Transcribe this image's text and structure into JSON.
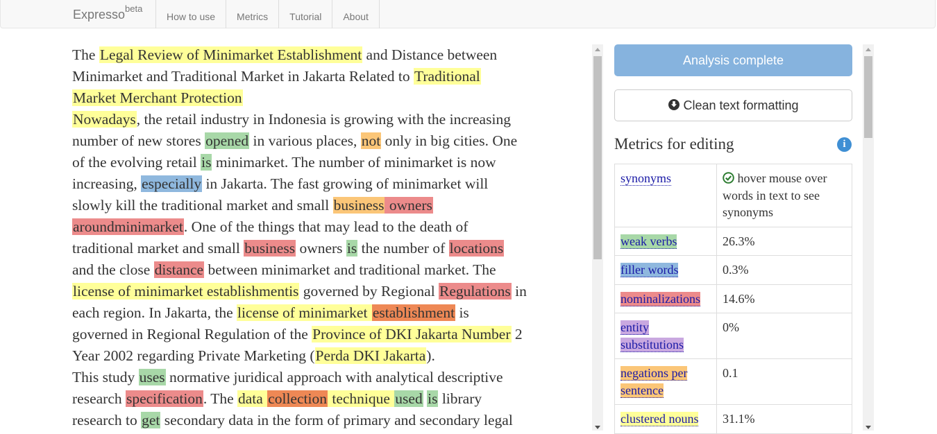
{
  "navbar": {
    "brand": "Expresso",
    "brand_sup": "beta",
    "items": [
      "How to use",
      "Metrics",
      "Tutorial",
      "About"
    ]
  },
  "text_lines": [
    [
      [
        "",
        "The "
      ],
      [
        "y",
        "Legal Review of Minimarket Establishment"
      ],
      [
        "",
        " and Distance between"
      ]
    ],
    [
      [
        "",
        "Minimarket and Traditional Market in Jakarta Related to "
      ],
      [
        "y",
        "Traditional "
      ]
    ],
    [
      [
        "y",
        "Market Merchant Protection"
      ]
    ],
    [
      [
        "y",
        "Nowadays"
      ],
      [
        "",
        ", the retail industry in Indonesia is growing with the increasing"
      ]
    ],
    [
      [
        "",
        "number of new stores "
      ],
      [
        "g",
        "opened"
      ],
      [
        "",
        " in various places, "
      ],
      [
        "o",
        "not"
      ],
      [
        "",
        " only in big cities. One"
      ]
    ],
    [
      [
        "",
        "of the evolving retail "
      ],
      [
        "g",
        "is"
      ],
      [
        "",
        " minimarket. The number of minimarket is now"
      ]
    ],
    [
      [
        "",
        "increasing, "
      ],
      [
        "b",
        "especially"
      ],
      [
        "",
        " in Jakarta. The fast growing of minimarket will"
      ]
    ],
    [
      [
        "",
        "slowly kill the traditional market and small "
      ],
      [
        "o",
        "business"
      ],
      [
        "r",
        " owners "
      ]
    ],
    [
      [
        "r",
        "aroundminimarket"
      ],
      [
        "",
        ". One of the things that may lead to the death of"
      ]
    ],
    [
      [
        "",
        "traditional market and small "
      ],
      [
        "r",
        "business"
      ],
      [
        "",
        " owners "
      ],
      [
        "g",
        "is"
      ],
      [
        "",
        " the number of "
      ],
      [
        "r",
        "locations"
      ]
    ],
    [
      [
        "",
        "and the close "
      ],
      [
        "r",
        "distance"
      ],
      [
        "",
        " between minimarket and traditional market. The"
      ]
    ],
    [
      [
        "y",
        "license of minimarket establishmentis"
      ],
      [
        "",
        " governed by Regional "
      ],
      [
        "r",
        "Regulations"
      ],
      [
        "",
        " in"
      ]
    ],
    [
      [
        "",
        "each region. In Jakarta, the "
      ],
      [
        "y",
        "license of minimarket "
      ],
      [
        "dr",
        "establishment"
      ],
      [
        "",
        " is"
      ]
    ],
    [
      [
        "",
        "governed in Regional Regulation of the "
      ],
      [
        "y",
        "Province of DKI Jakarta Number"
      ],
      [
        "",
        " 2"
      ]
    ],
    [
      [
        "",
        "Year 2002 regarding Private Marketing ("
      ],
      [
        "y",
        "Perda DKI Jakarta"
      ],
      [
        "",
        ")."
      ]
    ],
    [
      [
        "",
        "This study "
      ],
      [
        "g",
        "uses"
      ],
      [
        "",
        " normative juridical approach with analytical descriptive"
      ]
    ],
    [
      [
        "",
        "research "
      ],
      [
        "r",
        "specification"
      ],
      [
        "",
        ". The "
      ],
      [
        "y",
        "data "
      ],
      [
        "dr",
        "collection"
      ],
      [
        "y",
        " technique "
      ],
      [
        "g",
        "used"
      ],
      [
        "",
        " "
      ],
      [
        "g",
        "is"
      ],
      [
        "",
        " library"
      ]
    ],
    [
      [
        "",
        "research to "
      ],
      [
        "g",
        "get"
      ],
      [
        "",
        " secondary data in the form of primary and secondary legal"
      ]
    ]
  ],
  "panel": {
    "analysis_button": "Analysis complete",
    "clean_button": "Clean text formatting",
    "metrics_title": "Metrics for editing",
    "metrics": [
      {
        "label": "synonyms",
        "value": "hover mouse over words in text to see synonyms",
        "cls": "",
        "check": true
      },
      {
        "label": "weak verbs",
        "value": "26.3%",
        "cls": "m-weak"
      },
      {
        "label": "filler words",
        "value": "0.3%",
        "cls": "m-filler"
      },
      {
        "label": "nominalizations",
        "value": "14.6%",
        "cls": "m-nom"
      },
      {
        "label": "entity substitutions",
        "value": "0%",
        "cls": "m-ent"
      },
      {
        "label": "negations per sentence",
        "value": "0.1",
        "cls": "m-neg"
      },
      {
        "label": "clustered nouns",
        "value": "31.1%",
        "cls": "m-clu"
      }
    ]
  },
  "colors": {
    "highlight_yellow": "#ffff99",
    "highlight_green": "#a8d8a8",
    "highlight_orange": "#fbc678",
    "highlight_blue": "#8fb8de",
    "highlight_red": "#ec8b8b",
    "highlight_dark_orange": "#ee8855",
    "analysis_button_bg": "#86b3de",
    "info_icon": "#3f8fd4",
    "check_icon": "#2e7d32"
  }
}
